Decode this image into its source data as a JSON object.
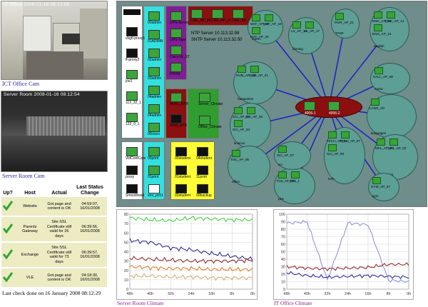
{
  "cams": {
    "ict_stamp": "IT Office 2008-01-16 08:12:55",
    "ict_caption": "ICT Office Cam",
    "server_stamp": "Server Room 2008-01-16 08:12:54",
    "server_caption": "Server Room Cam"
  },
  "status": {
    "headers": [
      "Up?",
      "Host",
      "Actual",
      "Last Status Change"
    ],
    "rows": [
      {
        "host": "Website",
        "actual": "Got page and content is OK",
        "changed": "04:59:07, 16/01/2008"
      },
      {
        "host": "Parentz Gateway",
        "actual": "Site SSL Certificate still valid for 26 days",
        "changed": "06:39:56, 16/01/2008"
      },
      {
        "host": "Exchange",
        "actual": "Site SSL Certificate still valid for 73 days",
        "changed": "06:39:57, 16/01/2008"
      },
      {
        "host": "VLE",
        "actual": "Got page and content is OK",
        "changed": "04:18:30, 16/01/2008"
      }
    ],
    "last_check": "Last check done on 16 January 2008   08:12:29"
  },
  "network": {
    "col1": [
      "vhgfl-proxy1",
      "ff-proxy2",
      "joe1",
      "113_32_1",
      "123_0_1"
    ],
    "col2": [
      "00admin",
      "01ADMIN",
      "02admin",
      "03admin",
      "04admin",
      "04admin",
      "00cisco"
    ],
    "col3": [
      "UPS-Server",
      "UPS-Tape",
      "Cisco-W_ST",
      "PRVM"
    ],
    "col4": [
      "ADSL_RTR",
      "4006_RTR"
    ],
    "top_row": [
      "CRE_AP_08",
      "CRE_AP_11",
      "CRE_AP_12"
    ],
    "ntp": "NTP Server 10.113.32.98",
    "sntp": "SNTP Server 10.113.32.50",
    "climate": [
      "Server_Climate",
      "Office_Climate"
    ],
    "bottom1": [
      "VidConfCam",
      "proxy",
      "Smoothwall"
    ],
    "bottom2": [
      "00print",
      "01print",
      "smr_pc01"
    ],
    "bottom3": [
      "00student",
      "01student",
      "03student",
      "04student",
      "11print",
      "00backup"
    ],
    "core": [
      "4006-1",
      "4006-2"
    ],
    "clusters": [
      {
        "aps": [
          "MAT_AP_18",
          "MAT_AP_19",
          "MAT_AP_20"
        ],
        "sub": "maths"
      },
      {
        "aps": [
          "LS_AP_18",
          "LS_AP_17"
        ],
        "sub": "dinning"
      },
      {
        "aps": [
          "TAVR_AP_21"
        ],
        "sub": "TAVR"
      },
      {
        "aps": [
          "ENG_AP_13",
          "ENG_AP_14",
          "ENG_AP_15"
        ],
        "sub": "english"
      },
      {
        "aps": [
          "HUM_AP_22",
          "HUM_AP_21"
        ],
        "sub": "humanities"
      },
      {
        "aps": [
          "HALL_AP_08"
        ],
        "sub": "music"
      },
      {
        "aps": [
          "LANG_AP"
        ],
        "sub": "languages"
      },
      {
        "aps": [
          "SCI_AP_34",
          "SCI_AP_35",
          "SCI_AP_33"
        ],
        "sub": "science"
      },
      {
        "aps": [
          "MFL_AP_01",
          "MFL_AP_02"
        ],
        "sub": "connexions"
      },
      {
        "aps": [
          "TOC_AP_08"
        ],
        "sub": "office"
      },
      {
        "aps": [
          "TECH_AP_01",
          "TECH_AP_07",
          "SCI_AP_08"
        ],
        "sub": "tech"
      },
      {
        "aps": [
          "P16_AP_08",
          "STB_1"
        ],
        "sub": "p16"
      },
      {
        "aps": [
          "GYM_AP_07"
        ],
        "sub": "gym"
      },
      {
        "aps": [
          "SCI_AP_07"
        ],
        "sub": "sci"
      }
    ]
  },
  "charts": {
    "server_caption": "Server Room Climate",
    "office_caption": "IT Office Climate",
    "x_ticks": [
      "48h",
      "40h",
      "32h",
      "24h",
      "16h",
      "8h",
      "0h"
    ],
    "server_y_ticks": [
      "80",
      "70",
      "60",
      "50",
      "40",
      "30",
      "20",
      "10",
      "0"
    ],
    "office_y_ticks": [
      "100",
      "90",
      "80",
      "70",
      "60",
      "50",
      "40",
      "30",
      "20",
      "10",
      "0"
    ]
  },
  "chart_data": [
    {
      "type": "line",
      "caption": "Server Room Climate",
      "x": [
        "48h",
        "40h",
        "32h",
        "24h",
        "16h",
        "8h",
        "0h"
      ],
      "ylim": [
        0,
        80
      ],
      "series": [
        {
          "color": "#33cc33",
          "values": [
            76,
            74,
            73,
            76,
            75,
            74,
            74
          ]
        },
        {
          "color": "#1a1a8c",
          "values": [
            52,
            50,
            44,
            42,
            38,
            35,
            32
          ]
        },
        {
          "color": "#8b1a1a",
          "values": [
            33,
            32,
            31,
            30,
            30,
            30,
            31
          ]
        },
        {
          "color": "#e07020",
          "values": [
            24,
            23,
            22,
            22,
            21,
            21,
            21
          ]
        },
        {
          "color": "#ccaa66",
          "values": [
            14,
            14,
            13,
            13,
            12,
            12,
            12
          ]
        }
      ]
    },
    {
      "type": "line",
      "caption": "IT Office Climate",
      "x": [
        "48h",
        "40h",
        "32h",
        "24h",
        "16h",
        "8h",
        "0h"
      ],
      "ylim": [
        0,
        100
      ],
      "series": [
        {
          "color": "#8888dd",
          "values": [
            88,
            90,
            12,
            88,
            86,
            12,
            10
          ]
        },
        {
          "color": "#8b1a1a",
          "values": [
            30,
            28,
            27,
            28,
            29,
            33,
            33
          ]
        },
        {
          "color": "#1a1a8c",
          "values": [
            22,
            18,
            16,
            17,
            18,
            17,
            16
          ]
        }
      ]
    }
  ]
}
